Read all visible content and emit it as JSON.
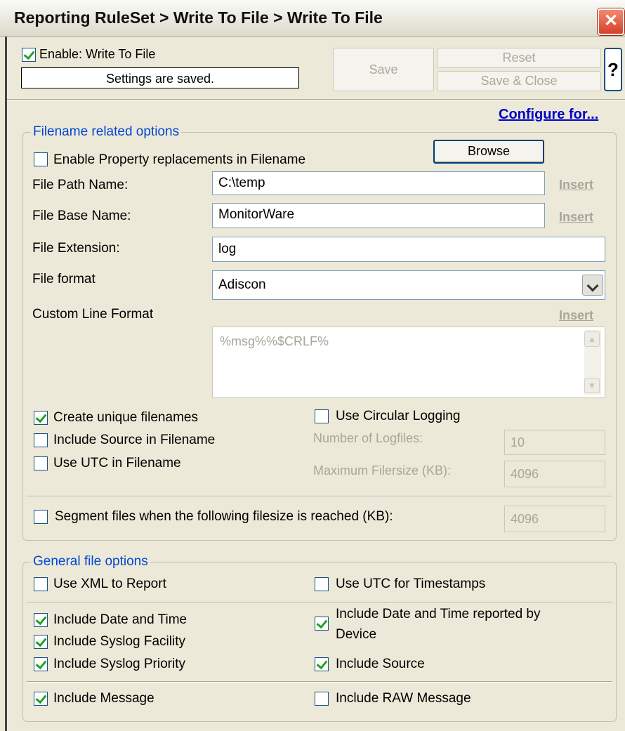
{
  "window": {
    "title": "Reporting RuleSet > Write To File > Write To File",
    "close_glyph": "✕"
  },
  "header": {
    "enable_label": "Enable: Write To File",
    "enable_checked": true,
    "status_text": "Settings are saved.",
    "save_label": "Save",
    "reset_label": "Reset",
    "save_close_label": "Save & Close",
    "help_label": "?",
    "configure_link": "Configure for..."
  },
  "filename_options": {
    "group_label": "Filename related options",
    "enable_property_replacements": {
      "label": "Enable Property replacements in Filename",
      "checked": false
    },
    "browse_label": "Browse",
    "file_path": {
      "label": "File Path Name:",
      "value": "C:\\temp",
      "insert": "Insert"
    },
    "file_base": {
      "label": "File Base Name:",
      "value": "MonitorWare",
      "insert": "Insert"
    },
    "file_extension": {
      "label": "File Extension:",
      "value": "log"
    },
    "file_format": {
      "label": "File format",
      "value": "Adiscon"
    },
    "custom_line_format": {
      "label": "Custom Line Format",
      "value": "%msg%%$CRLF%",
      "insert": "Insert"
    },
    "create_unique": {
      "label": "Create unique filenames",
      "checked": true
    },
    "include_source": {
      "label": "Include Source in Filename",
      "checked": false
    },
    "use_utc": {
      "label": "Use UTC in Filename",
      "checked": false
    },
    "circular_logging": {
      "label": "Use Circular Logging",
      "checked": false
    },
    "number_of_logfiles": {
      "label": "Number of Logfiles:",
      "value": "10"
    },
    "max_filesize": {
      "label": "Maximum Filersize (KB):",
      "value": "4096"
    },
    "segment_files": {
      "label": "Segment files when the following filesize is reached (KB):",
      "checked": false,
      "value": "4096"
    }
  },
  "general_options": {
    "group_label": "General file options",
    "use_xml": {
      "label": "Use XML to Report",
      "checked": false
    },
    "use_utc_timestamps": {
      "label": "Use UTC for Timestamps",
      "checked": false
    },
    "include_date_time": {
      "label": "Include Date and Time",
      "checked": true
    },
    "include_device_time_line1": "Include Date and Time reported by",
    "include_device_time_line2": "Device",
    "include_device_time_checked": true,
    "include_facility": {
      "label": "Include Syslog Facility",
      "checked": true
    },
    "include_priority": {
      "label": "Include Syslog Priority",
      "checked": true
    },
    "include_source": {
      "label": "Include Source",
      "checked": true
    },
    "include_message": {
      "label": "Include Message",
      "checked": true
    },
    "include_raw": {
      "label": "Include RAW Message",
      "checked": false
    }
  }
}
